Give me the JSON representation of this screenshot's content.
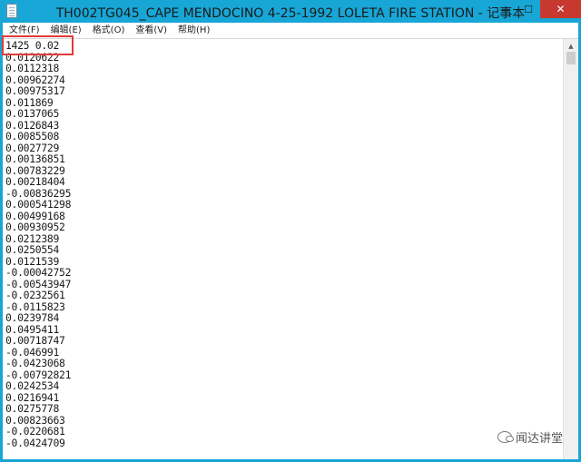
{
  "window": {
    "title": "TH002TG045_CAPE MENDOCINO 4-25-1992 LOLETA FIRE STATION - 记事本",
    "controls": {
      "minimize": "—",
      "maximize": "☐",
      "close": "✕"
    }
  },
  "menu": {
    "items": [
      {
        "label": "文件(F)"
      },
      {
        "label": "编辑(E)"
      },
      {
        "label": "格式(O)"
      },
      {
        "label": "查看(V)"
      },
      {
        "label": "帮助(H)"
      }
    ]
  },
  "document": {
    "lines": [
      "1425 0.02",
      "0.0120622",
      "0.0112318",
      "0.00962274",
      "0.00975317",
      "0.011869",
      "0.0137065",
      "0.0126843",
      "0.0085508",
      "0.0027729",
      "0.00136851",
      "0.00783229",
      "0.00218404",
      "-0.00836295",
      "0.000541298",
      "0.00499168",
      "0.00930952",
      "0.0212389",
      "0.0250554",
      "0.0121539",
      "-0.00042752",
      "-0.00543947",
      "-0.0232561",
      "-0.0115823",
      "0.0239784",
      "0.0495411",
      "0.00718747",
      "-0.046991",
      "-0.0423068",
      "-0.00792821",
      "0.0242534",
      "0.0216941",
      "0.0275778",
      "0.00823663",
      "-0.0220681",
      "-0.0424709"
    ]
  },
  "watermark": {
    "text": "闻达讲堂",
    "icon": "wechat-icon"
  },
  "colors": {
    "titlebar": "#17a6d6",
    "close_button": "#c7382f",
    "highlight_box": "#e23a3a"
  }
}
